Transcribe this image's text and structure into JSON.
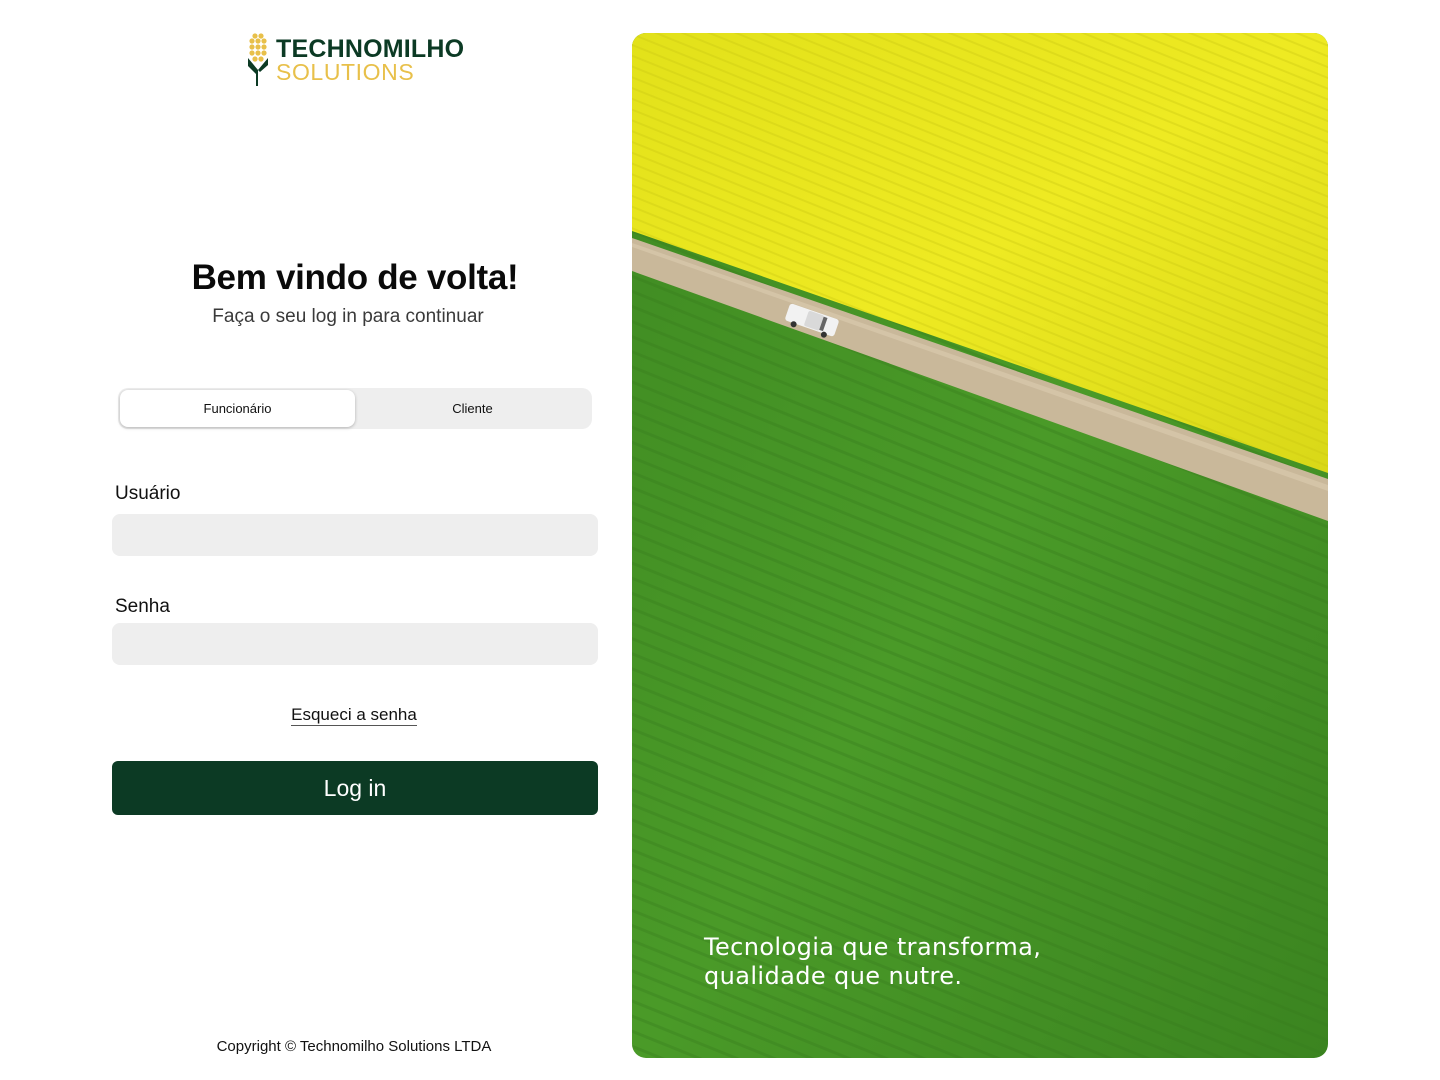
{
  "brand": {
    "name_line1": "TECHNOMILHO",
    "name_line2": "SOLUTIONS",
    "logo_icon": "corn-cob-icon",
    "primary_color": "#0c3a24",
    "accent_color": "#e8c04a"
  },
  "welcome": {
    "title": "Bem vindo de volta!",
    "subtitle": "Faça o seu log in para continuar"
  },
  "account_type": {
    "options": [
      {
        "label": "Funcionário",
        "selected": true
      },
      {
        "label": "Cliente",
        "selected": false
      }
    ]
  },
  "form": {
    "username_label": "Usuário",
    "username_value": "",
    "password_label": "Senha",
    "password_value": "",
    "forgot_password": "Esqueci a senha",
    "submit_label": "Log in"
  },
  "footer": {
    "copyright": "Copyright © Technomilho Solutions LTDA"
  },
  "hero": {
    "tagline_line1": "Tecnologia que transforma,",
    "tagline_line2": "qualidade que nutre.",
    "image_subject": "aerial-farm-fields-photo"
  }
}
